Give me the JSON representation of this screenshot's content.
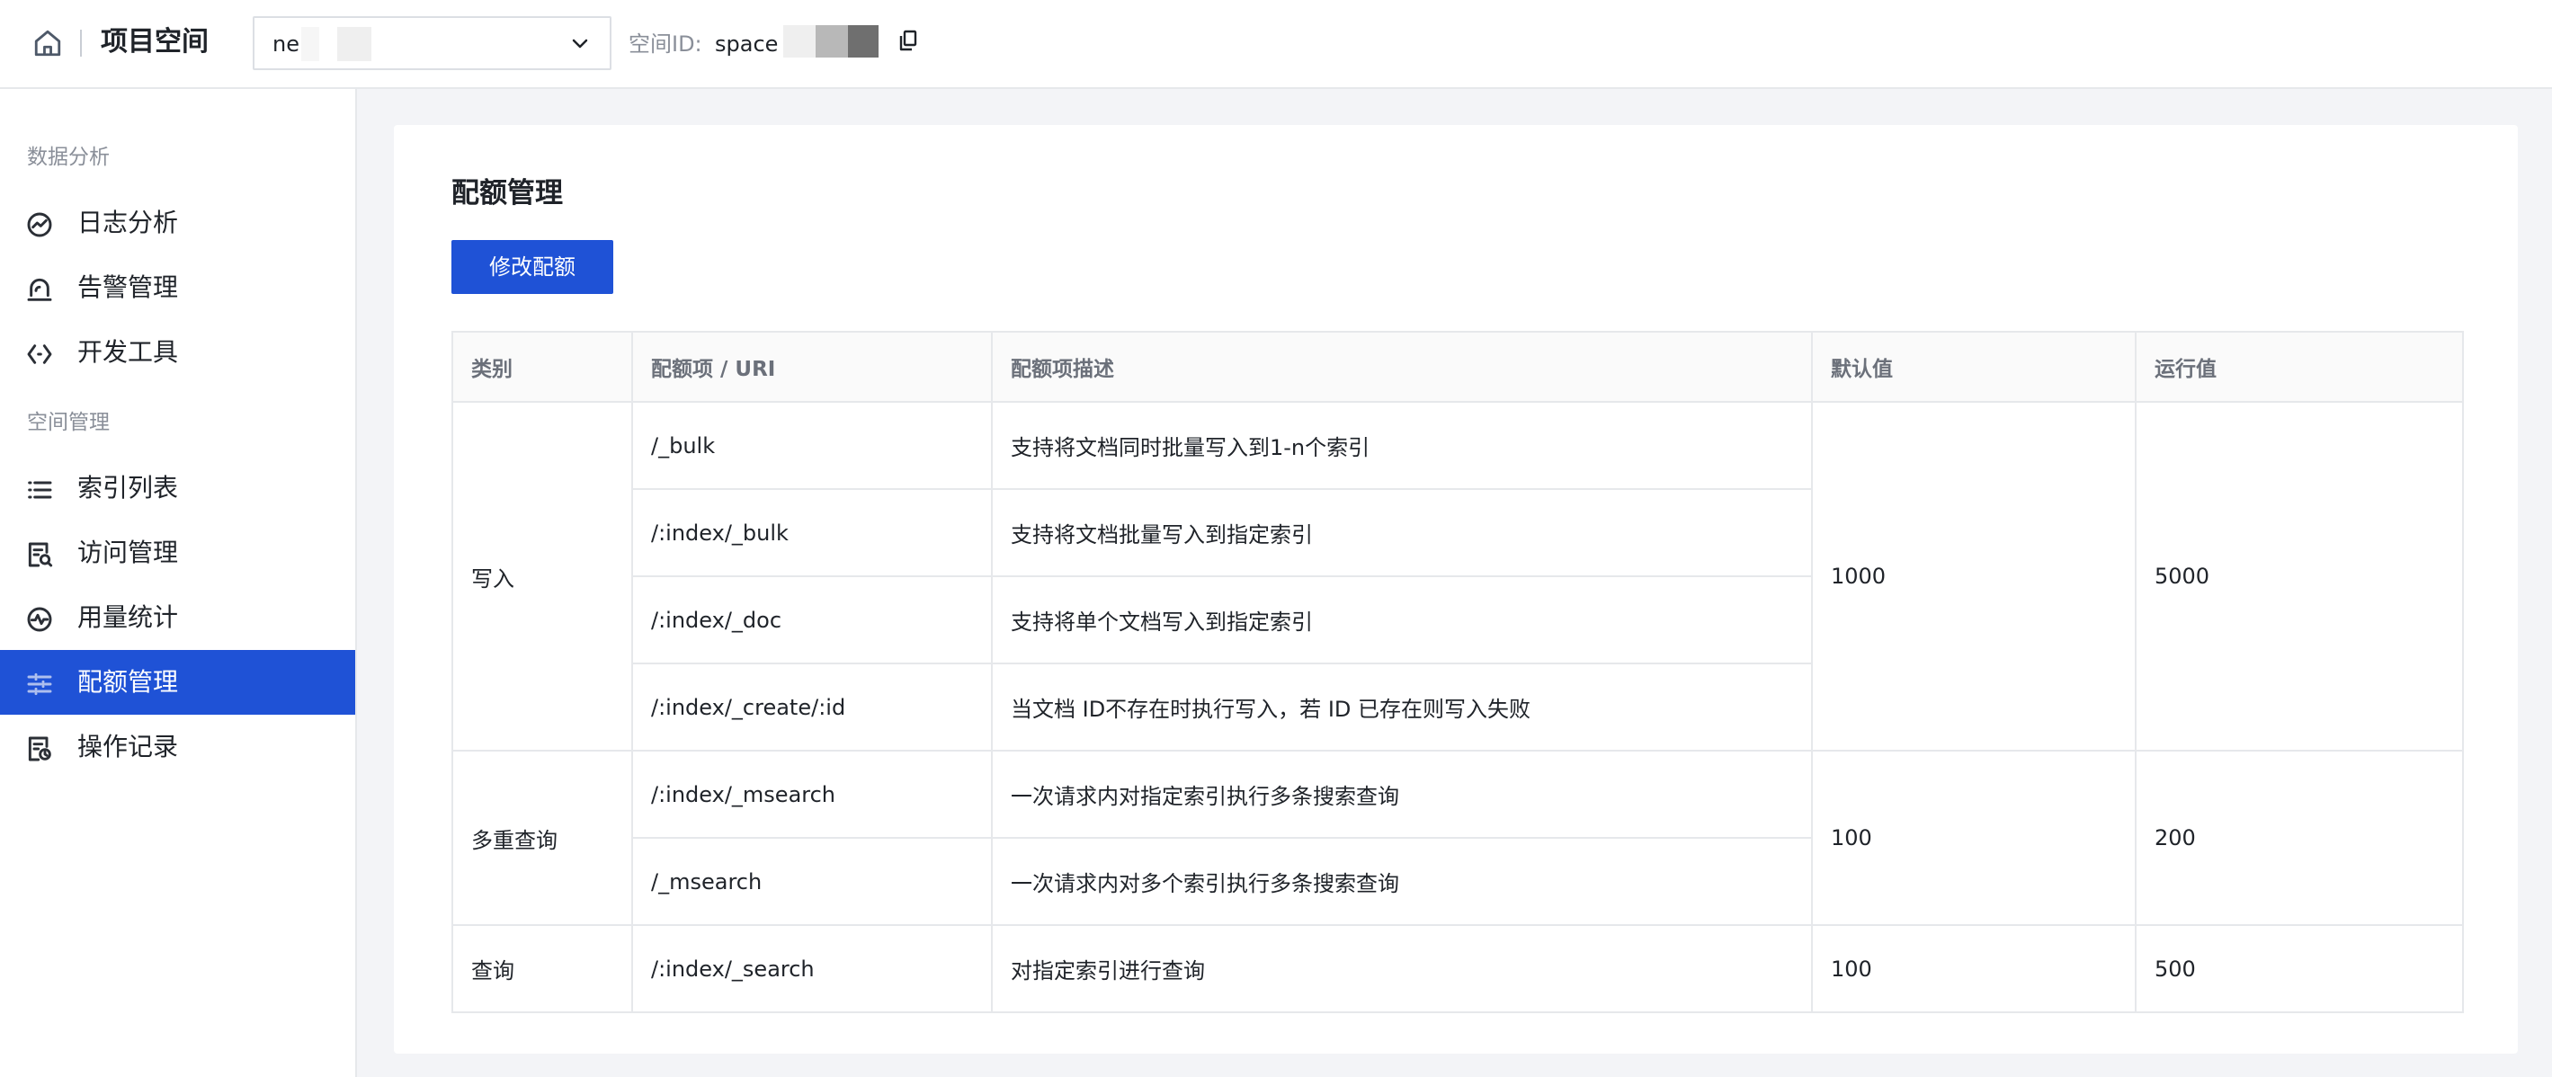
{
  "header": {
    "app_title": "项目空间",
    "space_select_value": "ne",
    "space_id_label": "空间ID:",
    "space_id_value": "space"
  },
  "sidebar": {
    "groups": [
      {
        "title": "数据分析",
        "items": [
          {
            "label": "日志分析",
            "icon": "log-analysis-icon"
          },
          {
            "label": "告警管理",
            "icon": "alarm-icon"
          },
          {
            "label": "开发工具",
            "icon": "code-icon"
          }
        ]
      },
      {
        "title": "空间管理",
        "items": [
          {
            "label": "索引列表",
            "icon": "list-icon"
          },
          {
            "label": "访问管理",
            "icon": "access-icon"
          },
          {
            "label": "用量统计",
            "icon": "usage-icon"
          },
          {
            "label": "配额管理",
            "icon": "quota-icon",
            "active": true
          },
          {
            "label": "操作记录",
            "icon": "record-icon"
          }
        ]
      }
    ]
  },
  "main": {
    "title": "配额管理",
    "edit_button": "修改配额",
    "table": {
      "headers": [
        "类别",
        "配额项 / URI",
        "配额项描述",
        "默认值",
        "运行值"
      ],
      "groups": [
        {
          "category": "写入",
          "default": "1000",
          "running": "5000",
          "rows": [
            {
              "uri": "/_bulk",
              "desc": "支持将文档同时批量写入到1-n个索引"
            },
            {
              "uri": "/:index/_bulk",
              "desc": "支持将文档批量写入到指定索引"
            },
            {
              "uri": "/:index/_doc",
              "desc": "支持将单个文档写入到指定索引"
            },
            {
              "uri": "/:index/_create/:id",
              "desc": "当文档 ID不存在时执行写入，若 ID 已存在则写入失败"
            }
          ]
        },
        {
          "category": "多重查询",
          "default": "100",
          "running": "200",
          "rows": [
            {
              "uri": "/:index/_msearch",
              "desc": "一次请求内对指定索引执行多条搜索查询"
            },
            {
              "uri": "/_msearch",
              "desc": "一次请求内对多个索引执行多条搜索查询"
            }
          ]
        },
        {
          "category": "查询",
          "default": "100",
          "running": "500",
          "rows": [
            {
              "uri": "/:index/_search",
              "desc": "对指定索引进行查询"
            }
          ]
        }
      ]
    }
  },
  "colors": {
    "accent": "#1f52d6",
    "border": "#e6e8eb",
    "muted_text": "#8a8f99"
  }
}
